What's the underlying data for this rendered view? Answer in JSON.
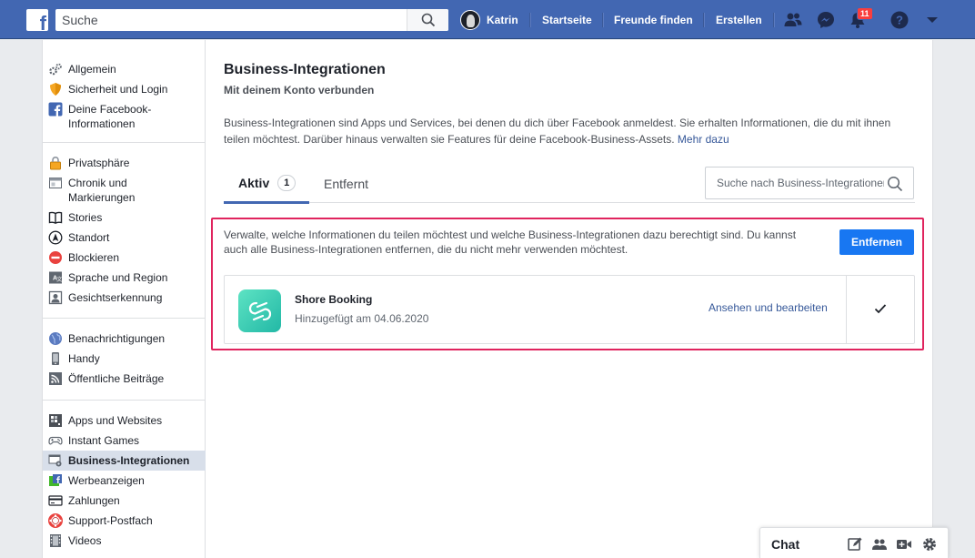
{
  "topbar": {
    "logo": "f",
    "search_placeholder": "Suche",
    "user_name": "Katrin",
    "nav": [
      "Startseite",
      "Freunde finden",
      "Erstellen"
    ],
    "notification_count": "11",
    "colors": {
      "bar": "#4267b2",
      "badge": "#fa3e3e"
    }
  },
  "sidebar": {
    "groups": [
      [
        {
          "label": "Allgemein",
          "icon": "gears-icon"
        },
        {
          "label": "Sicherheit und Login",
          "icon": "shield-icon"
        },
        {
          "label": "Deine Facebook-Informationen",
          "icon": "facebook-icon"
        }
      ],
      [
        {
          "label": "Privatsphäre",
          "icon": "lock-icon"
        },
        {
          "label": "Chronik und Markierungen",
          "icon": "timeline-icon"
        },
        {
          "label": "Stories",
          "icon": "book-icon"
        },
        {
          "label": "Standort",
          "icon": "location-icon"
        },
        {
          "label": "Blockieren",
          "icon": "block-icon"
        },
        {
          "label": "Sprache und Region",
          "icon": "language-icon"
        },
        {
          "label": "Gesichtserkennung",
          "icon": "face-icon"
        }
      ],
      [
        {
          "label": "Benachrichtigungen",
          "icon": "globe-icon"
        },
        {
          "label": "Handy",
          "icon": "phone-icon"
        },
        {
          "label": "Öffentliche Beiträge",
          "icon": "rss-icon"
        }
      ],
      [
        {
          "label": "Apps und Websites",
          "icon": "apps-icon"
        },
        {
          "label": "Instant Games",
          "icon": "gamepad-icon"
        },
        {
          "label": "Business-Integrationen",
          "icon": "business-icon",
          "active": true
        },
        {
          "label": "Werbeanzeigen",
          "icon": "ads-icon"
        },
        {
          "label": "Zahlungen",
          "icon": "card-icon"
        },
        {
          "label": "Support-Postfach",
          "icon": "lifebuoy-icon"
        },
        {
          "label": "Videos",
          "icon": "film-icon"
        }
      ]
    ]
  },
  "main": {
    "title": "Business-Integrationen",
    "subtitle": "Mit deinem Konto verbunden",
    "description": "Business-Integrationen sind Apps und Services, bei denen du dich über Facebook anmeldest. Sie erhalten Informationen, die du mit ihnen teilen möchtest. Darüber hinaus verwalten sie Features für deine Facebook-Business-Assets. ",
    "learn_more": "Mehr dazu",
    "tabs": {
      "active": "Aktiv",
      "active_count": "1",
      "removed": "Entfernt"
    },
    "search_placeholder": "Suche nach Business-Integrationen",
    "manage_text": "Verwalte, welche Informationen du teilen möchtest und welche Business-Integrationen dazu berechtigt sind. Du kannst auch alle Business-Integrationen entfernen, die du nicht mehr verwenden möchtest.",
    "remove_button": "Entfernen",
    "app": {
      "name": "Shore Booking",
      "added": "Hinzugefügt am 04.06.2020",
      "edit_link": "Ansehen und bearbeiten",
      "checked": true
    }
  },
  "chat": {
    "label": "Chat"
  }
}
